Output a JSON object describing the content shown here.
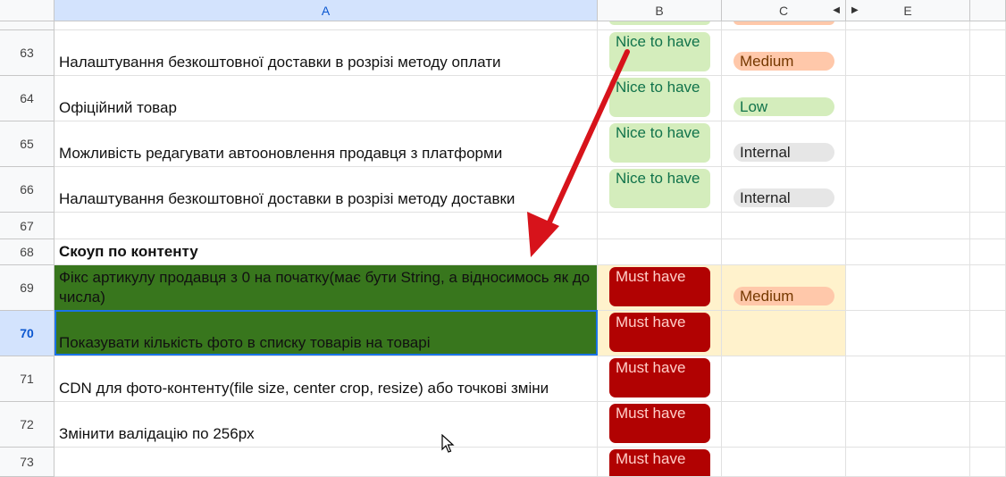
{
  "columns": {
    "a": "A",
    "b": "B",
    "c": "C",
    "e": "E"
  },
  "rows": [
    {
      "num": "63",
      "a": "Налаштування безкоштовної доставки в розрізі методу оплати",
      "b": "Nice to have",
      "c": "Medium"
    },
    {
      "num": "64",
      "a": "Офіційний товар",
      "b": "Nice to have",
      "c": "Low"
    },
    {
      "num": "65",
      "a": "Можливість редагувати автооновлення продавця з платформи",
      "b": "Nice to have",
      "c": "Internal"
    },
    {
      "num": "66",
      "a": "Налаштування безкоштовної доставки в розрізі методу доставки",
      "b": "Nice to have",
      "c": "Internal"
    },
    {
      "num": "67",
      "a": "",
      "b": "",
      "c": ""
    },
    {
      "num": "68",
      "a": "Скоуп по контенту",
      "b": "",
      "c": ""
    },
    {
      "num": "69",
      "a": "Фікс артикулу продавця з 0 на початку(має бути String, а відносимось як до числа)",
      "b": "Must have",
      "c": "Medium"
    },
    {
      "num": "70",
      "a": "Показувати кількість фото в списку товарів на товарі",
      "b": "Must have",
      "c": ""
    },
    {
      "num": "71",
      "a": "CDN для фото-контенту(file size, center crop, resize) або точкові зміни",
      "b": "Must have",
      "c": ""
    },
    {
      "num": "72",
      "a": "Змінити валідацію по 256px",
      "b": "Must have",
      "c": ""
    },
    {
      "num": "73",
      "a": "",
      "b": "Must have",
      "c": ""
    }
  ],
  "colors": {
    "accent": "#1a73e8",
    "must": "#b10202",
    "nice": "#d4edbc",
    "medium": "#ffc8aa",
    "green_fill": "#38761d",
    "arrow": "#d7131b"
  }
}
